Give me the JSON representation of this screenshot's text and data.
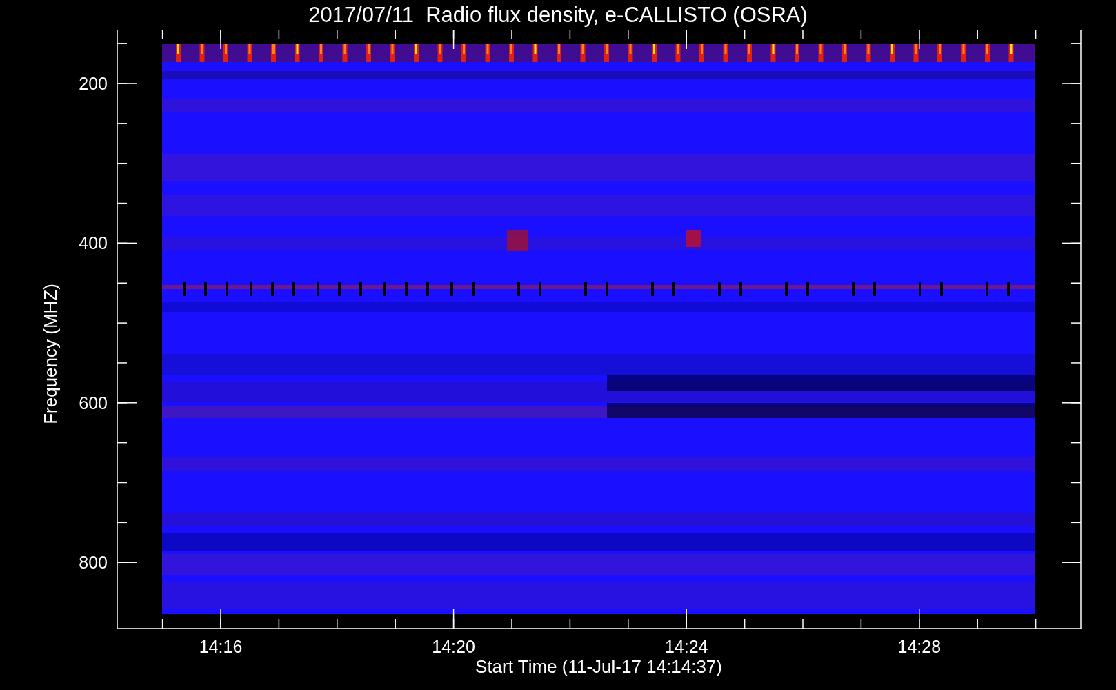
{
  "title": "2017/07/11  Radio flux density, e-CALLISTO (OSRA)",
  "y_axis": {
    "label": "Frequency (MHZ)",
    "ticks": [
      "200",
      "400",
      "600",
      "800"
    ]
  },
  "x_axis": {
    "label": "Start Time (11-Jul-17 14:14:37)",
    "ticks": [
      "14:16",
      "14:20",
      "14:24",
      "14:28"
    ]
  }
}
